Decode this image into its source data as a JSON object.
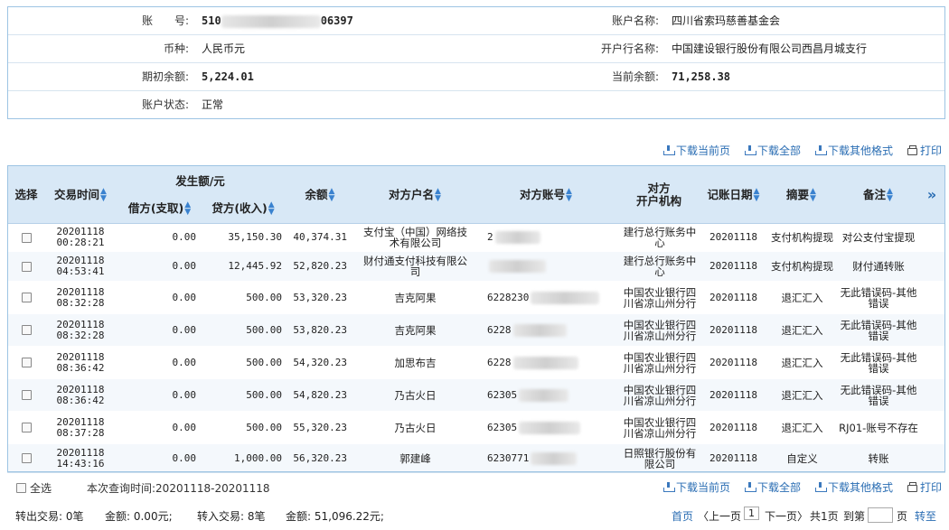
{
  "account": {
    "no_label": "账　　号:",
    "no_prefix": "510",
    "no_suffix": "06397",
    "name_label": "账户名称:",
    "name_value": "四川省索玛慈善基金会",
    "currency_label": "币种:",
    "currency_value": "人民币元",
    "bank_label": "开户行名称:",
    "bank_value": "中国建设银行股份有限公司西昌月城支行",
    "opening_label": "期初余额:",
    "opening_value": "5,224.01",
    "current_label": "当前余额:",
    "current_value": "71,258.38",
    "status_label": "账户状态:",
    "status_value": "正常"
  },
  "toolbar": {
    "download_current": "下载当前页",
    "download_all": "下载全部",
    "download_other": "下载其他格式",
    "print": "打印"
  },
  "table": {
    "headers": {
      "select": "选择",
      "time": "交易时间",
      "amount_group": "发生额/元",
      "debit": "借方(支取)",
      "credit": "贷方(收入)",
      "balance": "余额",
      "party_name": "对方户名",
      "party_account": "对方账号",
      "party_bank": "对方\n开户机构",
      "post_date": "记账日期",
      "summary": "摘要",
      "remark": "备注",
      "more": "»"
    },
    "rows": [
      {
        "date": "20201118",
        "time": "00:28:21",
        "debit": "0.00",
        "credit": "35,150.30",
        "balance": "40,374.31",
        "party": "支付宝（中国）网络技术有限公司",
        "acct_prefix": "2",
        "bank": "建行总行账务中心",
        "post": "20201118",
        "summary": "支付机构提现",
        "remark": "对公支付宝提现"
      },
      {
        "date": "20201118",
        "time": "04:53:41",
        "debit": "0.00",
        "credit": "12,445.92",
        "balance": "52,820.23",
        "party": "财付通支付科技有限公司",
        "acct_prefix": "",
        "bank": "建行总行账务中心",
        "post": "20201118",
        "summary": "支付机构提现",
        "remark": "财付通转账"
      },
      {
        "date": "20201118",
        "time": "08:32:28",
        "debit": "0.00",
        "credit": "500.00",
        "balance": "53,320.23",
        "party": "吉克阿果",
        "acct_prefix": "6228230",
        "bank": "中国农业银行四川省凉山州分行",
        "post": "20201118",
        "summary": "退汇汇入",
        "remark": "无此错误码-其他错误"
      },
      {
        "date": "20201118",
        "time": "08:32:28",
        "debit": "0.00",
        "credit": "500.00",
        "balance": "53,820.23",
        "party": "吉克阿果",
        "acct_prefix": "6228",
        "bank": "中国农业银行四川省凉山州分行",
        "post": "20201118",
        "summary": "退汇汇入",
        "remark": "无此错误码-其他错误"
      },
      {
        "date": "20201118",
        "time": "08:36:42",
        "debit": "0.00",
        "credit": "500.00",
        "balance": "54,320.23",
        "party": "加思布吉",
        "acct_prefix": "6228",
        "bank": "中国农业银行四川省凉山州分行",
        "post": "20201118",
        "summary": "退汇汇入",
        "remark": "无此错误码-其他错误"
      },
      {
        "date": "20201118",
        "time": "08:36:42",
        "debit": "0.00",
        "credit": "500.00",
        "balance": "54,820.23",
        "party": "乃古火日",
        "acct_prefix": "62305",
        "bank": "中国农业银行四川省凉山州分行",
        "post": "20201118",
        "summary": "退汇汇入",
        "remark": "无此错误码-其他错误"
      },
      {
        "date": "20201118",
        "time": "08:37:28",
        "debit": "0.00",
        "credit": "500.00",
        "balance": "55,320.23",
        "party": "乃古火日",
        "acct_prefix": "62305",
        "bank": "中国农业银行四川省凉山州分行",
        "post": "20201118",
        "summary": "退汇汇入",
        "remark": "RJ01-账号不存在"
      },
      {
        "date": "20201118",
        "time": "14:43:16",
        "debit": "0.00",
        "credit": "1,000.00",
        "balance": "56,320.23",
        "party": "郭建峰",
        "acct_prefix": "6230771",
        "bank": "日照银行股份有限公司",
        "post": "20201118",
        "summary": "自定义",
        "remark": "转账"
      }
    ]
  },
  "footer": {
    "select_all": "全选",
    "query_time": "本次查询时间:20201118-20201118",
    "out_count": "转出交易: 0笔",
    "out_amount": "金额: 0.00元;",
    "in_count": "转入交易: 8笔",
    "in_amount": "金额: 51,096.22元;",
    "first": "首页",
    "prev": "〈上一页",
    "page": "1",
    "next": "下一页〉",
    "total": "共1页",
    "goto_label": "到第",
    "goto_unit": "页",
    "go": "转至"
  }
}
